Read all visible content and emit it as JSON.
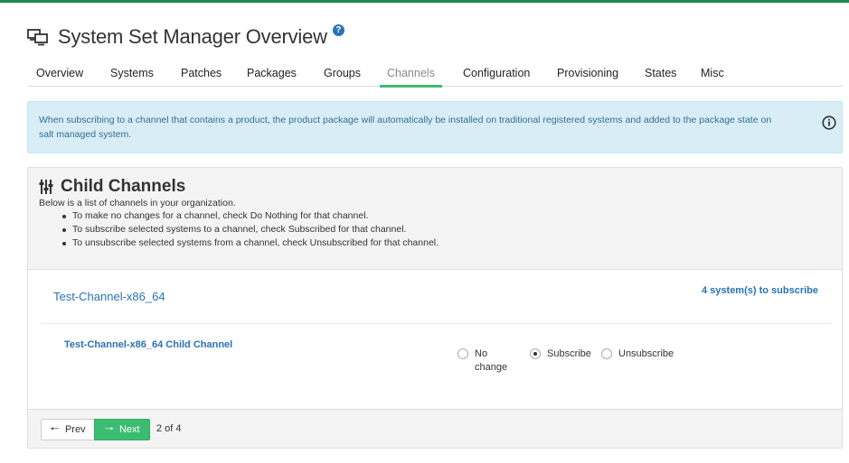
{
  "header": {
    "title": "System Set Manager Overview",
    "help_glyph": "?"
  },
  "tabs": [
    {
      "label": "Overview"
    },
    {
      "label": "Systems"
    },
    {
      "label": "Patches"
    },
    {
      "label": "Packages"
    },
    {
      "label": "Groups"
    },
    {
      "label": "Channels",
      "active": true
    },
    {
      "label": "Configuration"
    },
    {
      "label": "Provisioning"
    },
    {
      "label": "States"
    },
    {
      "label": "Misc"
    }
  ],
  "alert": {
    "text": "When subscribing to a channel that contains a product, the product package will automatically be installed on traditional registered systems and added to the package state on salt managed system.",
    "icon": "info-circle-icon"
  },
  "panel": {
    "icon": "sliders-icon",
    "title": "Child Channels",
    "description": "Below is a list of channels in your organization.",
    "bullets": [
      "To make no changes for a channel, check Do Nothing for that channel.",
      "To subscribe selected systems to a channel, check Subscribed for that channel.",
      "To unsubscribe selected systems from a channel, check Unsubscribed for that channel."
    ]
  },
  "channel": {
    "parent_name": "Test-Channel-x86_64",
    "subscribe_count": "4 system(s) to subscribe",
    "child_name": "Test-Channel-x86_64 Child Channel",
    "options": {
      "no_change": "No change",
      "subscribe": "Subscribe",
      "unsubscribe": "Unsubscribe"
    },
    "selected": "subscribe"
  },
  "pager": {
    "prev_label": "Prev",
    "next_label": "Next",
    "indicator": "2 of 4"
  },
  "colors": {
    "accent": "#3bbd71",
    "link": "#2a72b6",
    "alert_bg": "#d9edf7",
    "top_bar": "#1b8a4a"
  }
}
